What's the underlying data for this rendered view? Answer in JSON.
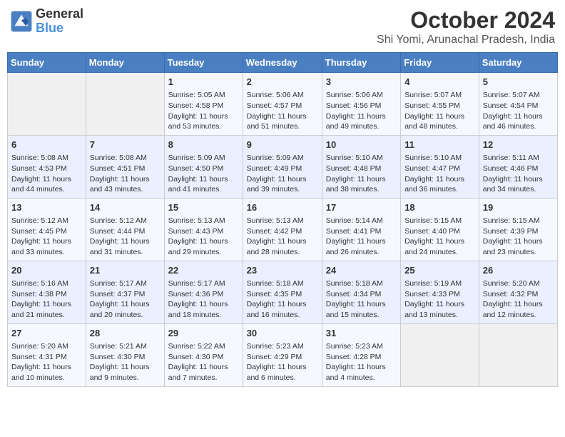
{
  "header": {
    "logo_line1": "General",
    "logo_line2": "Blue",
    "title": "October 2024",
    "subtitle": "Shi Yomi, Arunachal Pradesh, India"
  },
  "days_of_week": [
    "Sunday",
    "Monday",
    "Tuesday",
    "Wednesday",
    "Thursday",
    "Friday",
    "Saturday"
  ],
  "weeks": [
    [
      {
        "day": "",
        "sunrise": "",
        "sunset": "",
        "daylight": ""
      },
      {
        "day": "",
        "sunrise": "",
        "sunset": "",
        "daylight": ""
      },
      {
        "day": "1",
        "sunrise": "Sunrise: 5:05 AM",
        "sunset": "Sunset: 4:58 PM",
        "daylight": "Daylight: 11 hours and 53 minutes."
      },
      {
        "day": "2",
        "sunrise": "Sunrise: 5:06 AM",
        "sunset": "Sunset: 4:57 PM",
        "daylight": "Daylight: 11 hours and 51 minutes."
      },
      {
        "day": "3",
        "sunrise": "Sunrise: 5:06 AM",
        "sunset": "Sunset: 4:56 PM",
        "daylight": "Daylight: 11 hours and 49 minutes."
      },
      {
        "day": "4",
        "sunrise": "Sunrise: 5:07 AM",
        "sunset": "Sunset: 4:55 PM",
        "daylight": "Daylight: 11 hours and 48 minutes."
      },
      {
        "day": "5",
        "sunrise": "Sunrise: 5:07 AM",
        "sunset": "Sunset: 4:54 PM",
        "daylight": "Daylight: 11 hours and 46 minutes."
      }
    ],
    [
      {
        "day": "6",
        "sunrise": "Sunrise: 5:08 AM",
        "sunset": "Sunset: 4:53 PM",
        "daylight": "Daylight: 11 hours and 44 minutes."
      },
      {
        "day": "7",
        "sunrise": "Sunrise: 5:08 AM",
        "sunset": "Sunset: 4:51 PM",
        "daylight": "Daylight: 11 hours and 43 minutes."
      },
      {
        "day": "8",
        "sunrise": "Sunrise: 5:09 AM",
        "sunset": "Sunset: 4:50 PM",
        "daylight": "Daylight: 11 hours and 41 minutes."
      },
      {
        "day": "9",
        "sunrise": "Sunrise: 5:09 AM",
        "sunset": "Sunset: 4:49 PM",
        "daylight": "Daylight: 11 hours and 39 minutes."
      },
      {
        "day": "10",
        "sunrise": "Sunrise: 5:10 AM",
        "sunset": "Sunset: 4:48 PM",
        "daylight": "Daylight: 11 hours and 38 minutes."
      },
      {
        "day": "11",
        "sunrise": "Sunrise: 5:10 AM",
        "sunset": "Sunset: 4:47 PM",
        "daylight": "Daylight: 11 hours and 36 minutes."
      },
      {
        "day": "12",
        "sunrise": "Sunrise: 5:11 AM",
        "sunset": "Sunset: 4:46 PM",
        "daylight": "Daylight: 11 hours and 34 minutes."
      }
    ],
    [
      {
        "day": "13",
        "sunrise": "Sunrise: 5:12 AM",
        "sunset": "Sunset: 4:45 PM",
        "daylight": "Daylight: 11 hours and 33 minutes."
      },
      {
        "day": "14",
        "sunrise": "Sunrise: 5:12 AM",
        "sunset": "Sunset: 4:44 PM",
        "daylight": "Daylight: 11 hours and 31 minutes."
      },
      {
        "day": "15",
        "sunrise": "Sunrise: 5:13 AM",
        "sunset": "Sunset: 4:43 PM",
        "daylight": "Daylight: 11 hours and 29 minutes."
      },
      {
        "day": "16",
        "sunrise": "Sunrise: 5:13 AM",
        "sunset": "Sunset: 4:42 PM",
        "daylight": "Daylight: 11 hours and 28 minutes."
      },
      {
        "day": "17",
        "sunrise": "Sunrise: 5:14 AM",
        "sunset": "Sunset: 4:41 PM",
        "daylight": "Daylight: 11 hours and 26 minutes."
      },
      {
        "day": "18",
        "sunrise": "Sunrise: 5:15 AM",
        "sunset": "Sunset: 4:40 PM",
        "daylight": "Daylight: 11 hours and 24 minutes."
      },
      {
        "day": "19",
        "sunrise": "Sunrise: 5:15 AM",
        "sunset": "Sunset: 4:39 PM",
        "daylight": "Daylight: 11 hours and 23 minutes."
      }
    ],
    [
      {
        "day": "20",
        "sunrise": "Sunrise: 5:16 AM",
        "sunset": "Sunset: 4:38 PM",
        "daylight": "Daylight: 11 hours and 21 minutes."
      },
      {
        "day": "21",
        "sunrise": "Sunrise: 5:17 AM",
        "sunset": "Sunset: 4:37 PM",
        "daylight": "Daylight: 11 hours and 20 minutes."
      },
      {
        "day": "22",
        "sunrise": "Sunrise: 5:17 AM",
        "sunset": "Sunset: 4:36 PM",
        "daylight": "Daylight: 11 hours and 18 minutes."
      },
      {
        "day": "23",
        "sunrise": "Sunrise: 5:18 AM",
        "sunset": "Sunset: 4:35 PM",
        "daylight": "Daylight: 11 hours and 16 minutes."
      },
      {
        "day": "24",
        "sunrise": "Sunrise: 5:18 AM",
        "sunset": "Sunset: 4:34 PM",
        "daylight": "Daylight: 11 hours and 15 minutes."
      },
      {
        "day": "25",
        "sunrise": "Sunrise: 5:19 AM",
        "sunset": "Sunset: 4:33 PM",
        "daylight": "Daylight: 11 hours and 13 minutes."
      },
      {
        "day": "26",
        "sunrise": "Sunrise: 5:20 AM",
        "sunset": "Sunset: 4:32 PM",
        "daylight": "Daylight: 11 hours and 12 minutes."
      }
    ],
    [
      {
        "day": "27",
        "sunrise": "Sunrise: 5:20 AM",
        "sunset": "Sunset: 4:31 PM",
        "daylight": "Daylight: 11 hours and 10 minutes."
      },
      {
        "day": "28",
        "sunrise": "Sunrise: 5:21 AM",
        "sunset": "Sunset: 4:30 PM",
        "daylight": "Daylight: 11 hours and 9 minutes."
      },
      {
        "day": "29",
        "sunrise": "Sunrise: 5:22 AM",
        "sunset": "Sunset: 4:30 PM",
        "daylight": "Daylight: 11 hours and 7 minutes."
      },
      {
        "day": "30",
        "sunrise": "Sunrise: 5:23 AM",
        "sunset": "Sunset: 4:29 PM",
        "daylight": "Daylight: 11 hours and 6 minutes."
      },
      {
        "day": "31",
        "sunrise": "Sunrise: 5:23 AM",
        "sunset": "Sunset: 4:28 PM",
        "daylight": "Daylight: 11 hours and 4 minutes."
      },
      {
        "day": "",
        "sunrise": "",
        "sunset": "",
        "daylight": ""
      },
      {
        "day": "",
        "sunrise": "",
        "sunset": "",
        "daylight": ""
      }
    ]
  ]
}
